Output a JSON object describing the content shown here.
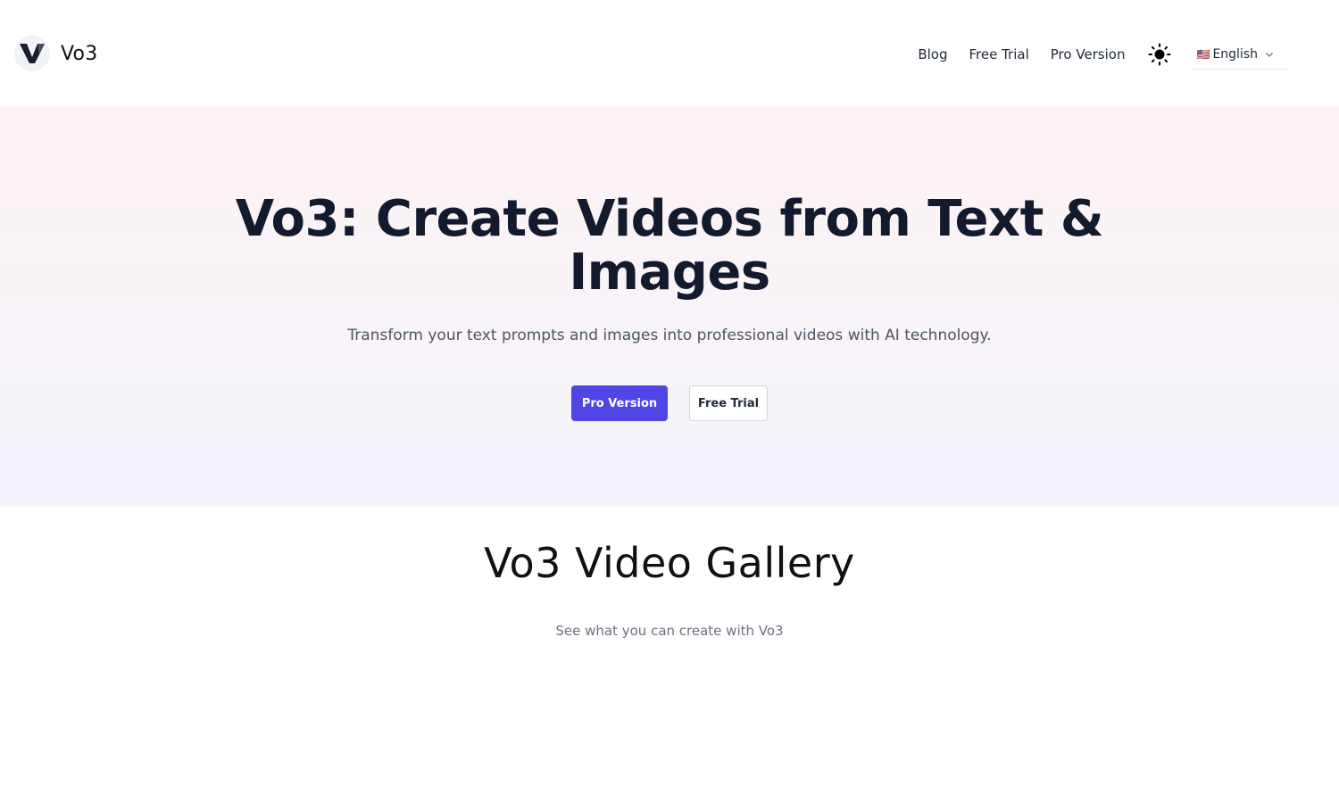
{
  "header": {
    "brand_name": "Vo3",
    "logo_icon": "v-logo-icon",
    "nav": {
      "blog": "Blog",
      "free_trial": "Free Trial",
      "pro_version": "Pro Version"
    },
    "theme_icon": "sun-icon",
    "language": {
      "flag": "🇺🇸",
      "selected": "English"
    }
  },
  "hero": {
    "title_line1": "Vo3: Create Videos from Text &",
    "title_line2": "Images",
    "subtitle": "Transform your text prompts and images into professional videos with AI technology.",
    "primary_button": "Pro Version",
    "secondary_button": "Free Trial"
  },
  "gallery": {
    "title": "Vo3 Video Gallery",
    "subtitle": "See what you can create with Vo3"
  },
  "colors": {
    "accent": "#4f46e5",
    "heading": "#141a2e",
    "hero_gradient_top": "#fdf3f4",
    "hero_gradient_bottom": "#f4f4fd"
  }
}
